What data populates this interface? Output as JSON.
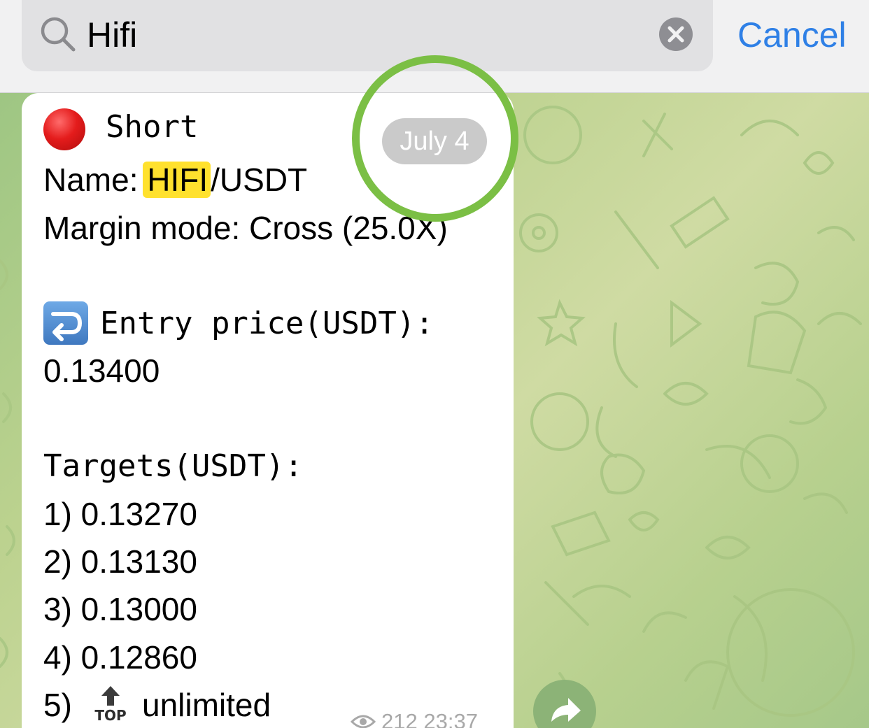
{
  "search": {
    "query": "Hifi",
    "cancel_label": "Cancel"
  },
  "message": {
    "short_label": "Short",
    "name_prefix": "Name: ",
    "name_highlight": "HIFI",
    "name_suffix": "/USDT",
    "margin_mode": "Margin mode: Cross (25.0X)",
    "entry_label": "Entry price(USDT):",
    "entry_value": "0.13400",
    "targets_label": "Targets(USDT):",
    "targets": [
      "1) 0.13270",
      "2) 0.13130",
      "3) 0.13000",
      "4) 0.12860"
    ],
    "target5_prefix": "5)",
    "target5_icon_text": "TOP",
    "target5_value": "unlimited",
    "views": "212",
    "time": "23:37"
  },
  "date_pill": "July 4",
  "icons": {
    "search": "search-icon",
    "clear": "clear-icon",
    "short_marker": "red-circle-icon",
    "entry": "right-arrow-curving-left-icon",
    "top": "top-arrow-icon",
    "views": "eye-icon",
    "forward": "forward-arrow-icon"
  },
  "colors": {
    "accent": "#2f80e6",
    "highlight": "#ffe12e",
    "ring": "#7bbf45",
    "short_red": "#e41c1c"
  }
}
